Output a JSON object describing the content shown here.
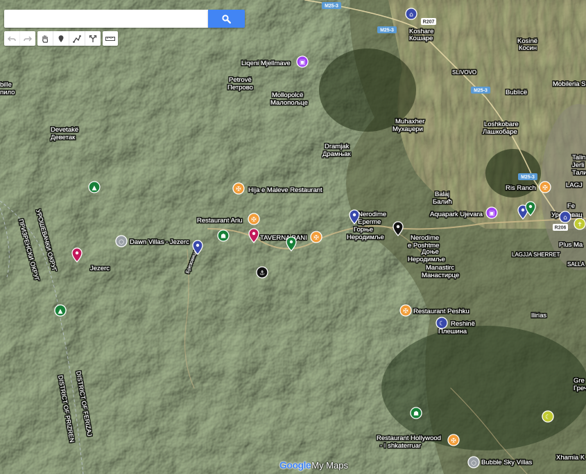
{
  "search": {
    "placeholder": "",
    "value": ""
  },
  "toolbar": {
    "undo": "undo-icon",
    "redo": "redo-icon",
    "pan": "hand-icon",
    "marker": "marker-icon",
    "draw_line": "draw-line-icon",
    "directions": "directions-icon",
    "ruler": "ruler-icon"
  },
  "attribution": {
    "brand": "Google",
    "product": "My Maps"
  },
  "colors": {
    "search_button": "#4285f4",
    "restaurant": "#f29d39",
    "park": "#188038",
    "place_blue": "#3949ab",
    "place_pink": "#c2185b",
    "place_purple": "#a142f4",
    "place_white": "#9aa0a6",
    "place_black": "#111111",
    "highway": "#5b9bd5"
  },
  "roads": [
    {
      "shield": "M25-3"
    },
    {
      "shield": "M25-3"
    },
    {
      "shield": "R207"
    },
    {
      "shield": "M25-3"
    },
    {
      "shield": "M25-3"
    },
    {
      "shield": "R206"
    }
  ],
  "places": [
    {
      "text": "Koshare"
    },
    {
      "text": "Кошаре"
    },
    {
      "text": "Kosinë"
    },
    {
      "text": "Косин"
    },
    {
      "text": "Liqeni Mjellmave"
    },
    {
      "text": "Petrovë"
    },
    {
      "text": "Петрово"
    },
    {
      "text": "Mollopolcë"
    },
    {
      "text": "Малопољце"
    },
    {
      "text": "SLIVOVO"
    },
    {
      "text": "Bublicë"
    },
    {
      "text": "Mobileria S"
    },
    {
      "text": "Muhaxher"
    },
    {
      "text": "Мухаџери"
    },
    {
      "text": "Loshkobare"
    },
    {
      "text": "Лашкобаре"
    },
    {
      "text": "Devetakë"
    },
    {
      "text": "Деветак"
    },
    {
      "text": "Dramjak"
    },
    {
      "text": "Драмњак"
    },
    {
      "text": "Talin"
    },
    {
      "text": "Jerli"
    },
    {
      "text": "Талин"
    },
    {
      "text": "Hija e Maleve Restaurant"
    },
    {
      "text": "Balaj"
    },
    {
      "text": "Балић"
    },
    {
      "text": "Ris Ranch"
    },
    {
      "text": "LAGJ"
    },
    {
      "text": "Aquapark Ujevara"
    },
    {
      "text": "Restaurant Ariu"
    },
    {
      "text": "Nerodime"
    },
    {
      "text": "Eperme"
    },
    {
      "text": "Горње"
    },
    {
      "text": "Неродимље"
    },
    {
      "text": "TAVERNA BANI"
    },
    {
      "text": "Dawn Villas - Jezerc"
    },
    {
      "text": "Nerodime"
    },
    {
      "text": "e Poshtme"
    },
    {
      "text": "Доње"
    },
    {
      "text": "Неродимље"
    },
    {
      "text": "Plus Ma"
    },
    {
      "text": "LAGJJA SHERRET"
    },
    {
      "text": "SALLA"
    },
    {
      "text": "Jezerc"
    },
    {
      "text": "Manastirc"
    },
    {
      "text": "Манастирце"
    },
    {
      "text": "Restaurant Peshku"
    },
    {
      "text": "Reshinë"
    },
    {
      "text": "Плешина"
    },
    {
      "text": "Ilirias"
    },
    {
      "text": "Gre"
    },
    {
      "text": "Греч"
    },
    {
      "text": "Restaurant Hollywood"
    },
    {
      "text": "- I shkaterruar"
    },
    {
      "text": "Bubble Sky Villas"
    },
    {
      "text": "Xhamia K"
    },
    {
      "text": "bille"
    },
    {
      "text": "пило"
    },
    {
      "text": "Fe"
    },
    {
      "text": "Урошевац"
    },
    {
      "text": "Брезовица"
    }
  ],
  "districts": [
    {
      "text": "УРОШЕВАЧКИ ОКРУГ"
    },
    {
      "text": "ПРИЗРЕНСКИ ОКРУГ"
    },
    {
      "text": "DISTRICT OF FERIZAJ"
    },
    {
      "text": "DISTRICT OF PRIZREN"
    }
  ],
  "markers": [
    {
      "icon": "museum-icon",
      "color": "#3949ab"
    },
    {
      "icon": "gallery-icon",
      "color": "#a142f4"
    },
    {
      "icon": "park-icon",
      "color": "#188038"
    },
    {
      "icon": "restaurant-icon",
      "color": "#f29d39"
    },
    {
      "icon": "restaurant-icon",
      "color": "#f29d39"
    },
    {
      "icon": "fountain-icon",
      "color": "#188038"
    },
    {
      "icon": "pin-icon",
      "color": "#c2185b"
    },
    {
      "icon": "restaurant-icon",
      "color": "#f29d39"
    },
    {
      "icon": "pin-icon",
      "color": "#188038"
    },
    {
      "icon": "pin-icon",
      "color": "#3949ab"
    },
    {
      "icon": "pin-icon",
      "color": "#111111"
    },
    {
      "icon": "hotel-icon",
      "color": "#9aa0a6"
    },
    {
      "icon": "pin-icon",
      "color": "#3949ab"
    },
    {
      "icon": "pin-icon",
      "color": "#c2185b"
    },
    {
      "icon": "park-icon",
      "color": "#188038"
    },
    {
      "icon": "anchor-icon",
      "color": "#111111"
    },
    {
      "icon": "gallery-icon",
      "color": "#a142f4"
    },
    {
      "icon": "pin-icon",
      "color": "#3949ab"
    },
    {
      "icon": "pin-icon",
      "color": "#188038"
    },
    {
      "icon": "museum-icon",
      "color": "#3949ab"
    },
    {
      "icon": "church-icon",
      "color": "#c0ca33"
    },
    {
      "icon": "restaurant-icon",
      "color": "#f29d39"
    },
    {
      "icon": "restaurant-icon",
      "color": "#f29d39"
    },
    {
      "icon": "mosque-icon",
      "color": "#3949ab"
    },
    {
      "icon": "fountain-icon",
      "color": "#188038"
    },
    {
      "icon": "restaurant-icon",
      "color": "#f29d39"
    },
    {
      "icon": "mosque-icon",
      "color": "#c0ca33"
    },
    {
      "icon": "hotel-icon",
      "color": "#9aa0a6"
    },
    {
      "icon": "park-icon",
      "color": "#188038"
    }
  ]
}
